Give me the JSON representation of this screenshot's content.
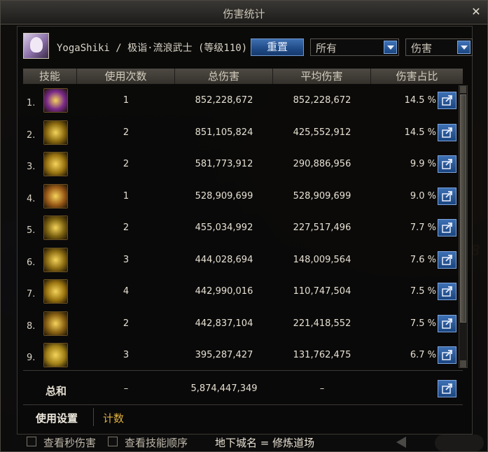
{
  "window": {
    "title": "伤害统计",
    "close": "✕"
  },
  "header": {
    "player": "YogaShiki / 极诣·流浪武士 (等级110)",
    "reset_label": "重置",
    "filter_selected": "所有",
    "metric_selected": "伤害"
  },
  "columns": [
    "技能",
    "使用次数",
    "总伤害",
    "平均伤害",
    "伤害占比"
  ],
  "rows": [
    {
      "rank": "1.",
      "uses": "1",
      "total": "852,228,672",
      "avg": "852,228,672",
      "pct": "14.5  %",
      "icon": "purple-cast-skill-icon",
      "color": "#7a2a8a"
    },
    {
      "rank": "2.",
      "uses": "2",
      "total": "851,105,824",
      "avg": "425,552,912",
      "pct": "14.5  %",
      "icon": "gold-slash-skill-icon",
      "color": "#8a6a10"
    },
    {
      "rank": "3.",
      "uses": "2",
      "total": "581,773,912",
      "avg": "290,886,956",
      "pct": "9.9  %",
      "icon": "gold-swirl-skill-icon",
      "color": "#9a7412"
    },
    {
      "rank": "4.",
      "uses": "1",
      "total": "528,909,699",
      "avg": "528,909,699",
      "pct": "9.0  %",
      "icon": "orange-burst-skill-icon",
      "color": "#9a5a18"
    },
    {
      "rank": "5.",
      "uses": "2",
      "total": "455,034,992",
      "avg": "227,517,496",
      "pct": "7.7  %",
      "icon": "cross-slash-skill-icon",
      "color": "#7a6010"
    },
    {
      "rank": "6.",
      "uses": "3",
      "total": "444,028,694",
      "avg": "148,009,564",
      "pct": "7.6  %",
      "icon": "gold-wave-skill-icon",
      "color": "#8a6a12"
    },
    {
      "rank": "7.",
      "uses": "4",
      "total": "442,990,016",
      "avg": "110,747,504",
      "pct": "7.5  %",
      "icon": "spark-burst-skill-icon",
      "color": "#9a7410"
    },
    {
      "rank": "8.",
      "uses": "2",
      "total": "442,837,104",
      "avg": "221,418,552",
      "pct": "7.5  %",
      "icon": "palm-seal-skill-icon",
      "color": "#8a6214"
    },
    {
      "rank": "9.",
      "uses": "3",
      "total": "395,287,427",
      "avg": "131,762,475",
      "pct": "6.7  %",
      "icon": "lotus-skill-icon",
      "color": "#a08018"
    }
  ],
  "total": {
    "label": "总和",
    "uses": "–",
    "total": "5,874,447,349",
    "avg": "–"
  },
  "tabs": {
    "settings": "使用设置",
    "count": "计数"
  },
  "footer": {
    "dps_label": "查看秒伤害",
    "order_label": "查看技能顺序",
    "dungeon": "地下城名 = 修炼道场"
  },
  "colors": {
    "accent_blue": "#2a5a9a",
    "tab_active_gold": "#e0b040"
  }
}
